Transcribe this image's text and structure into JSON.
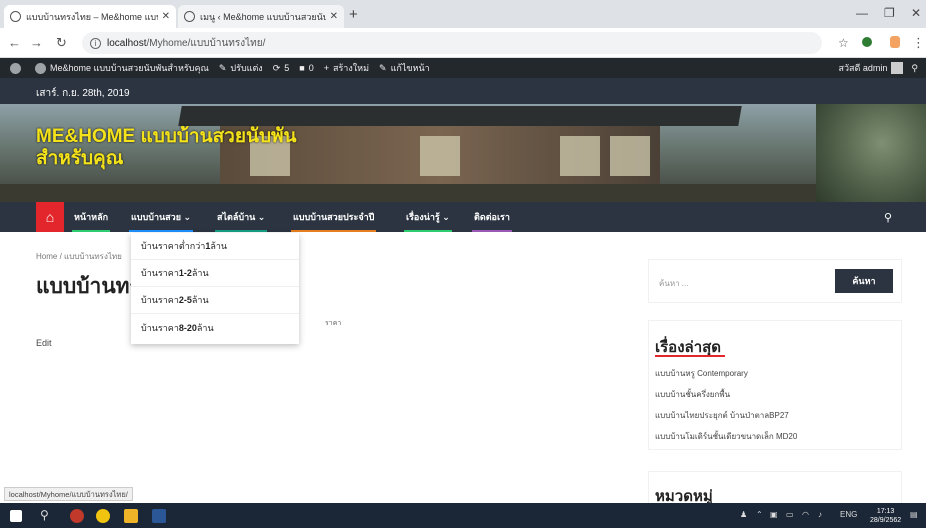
{
  "browser": {
    "tabs": [
      {
        "label": "แบบบ้านทรงไทย – Me&home แบบบ้",
        "active": true
      },
      {
        "label": "เมนู ‹ Me&home แบบบ้านสวยนับพัน",
        "active": false
      }
    ],
    "url_host": "localhost",
    "url_path": "/Myhome/แบบบ้านทรงไทย/"
  },
  "adminbar": {
    "site_name": "Me&home แบบบ้านสวยนับพันสำหรับคุณ",
    "customize": "ปรับแต่ง",
    "updates": "5",
    "comments": "0",
    "new": "สร้างใหม่",
    "edit_page": "แก้ไขหน้า",
    "greeting": "สวัสดี admin"
  },
  "header": {
    "date": "เสาร์. ก.ย. 28th, 2019",
    "site_title": "ME&HOME แบบบ้านสวยนับพันสำหรับคุณ"
  },
  "nav": {
    "items": [
      {
        "label": "หน้าหลัก",
        "underline": "#2ecc71"
      },
      {
        "label": "แบบบ้านสวย ⌄",
        "underline": "#1e90ff"
      },
      {
        "label": "สไตล์บ้าน ⌄",
        "underline": "#16a085"
      },
      {
        "label": "แบบบ้านสวยประจำปี",
        "underline": "#e67e22"
      },
      {
        "label": "เรื่องน่ารู้ ⌄",
        "underline": "#2ecc71"
      },
      {
        "label": "ติดต่อเรา",
        "underline": "#9b59b6"
      }
    ],
    "dropdown": [
      {
        "prefix": "บ้านราคาต่ำกว่า ",
        "bold": "1",
        "suffix": " ล้าน"
      },
      {
        "prefix": "บ้านราคา ",
        "bold": "1-2",
        "suffix": " ล้าน"
      },
      {
        "prefix": "บ้านราคา ",
        "bold": "2-5",
        "suffix": " ล้าน"
      },
      {
        "prefix": "บ้านราคา ",
        "bold": "8-20",
        "suffix": " ล้าน"
      }
    ]
  },
  "content": {
    "breadcrumb_home": "Home",
    "breadcrumb_sep": "/",
    "breadcrumb_current": "แบบบ้านทรงไทย",
    "page_title": "แบบบ้านทรงไทย",
    "price_label": "ราคา",
    "edit": "Edit"
  },
  "sidebar": {
    "search_placeholder": "ค้นหา ...",
    "search_button": "ค้นหา",
    "recent_title": "เรื่องล่าสุด",
    "recent_posts": [
      "แบบบ้านหรู Contemporary",
      "แบบบ้านชั้นครึ่งยกพื้น",
      "แบบบ้านไทยประยุกต์ บ้านป่าตาลBP27",
      "แบบบ้านโมเดิร์นชั้นเดียวขนาดเล็ก MD20"
    ],
    "categories_title": "หมวดหมู่"
  },
  "statusbar": "localhost/Myhome/แบบบ้านทรงไทย/",
  "taskbar": {
    "lang": "ENG",
    "time": "17:13",
    "date": "28/9/2562"
  }
}
